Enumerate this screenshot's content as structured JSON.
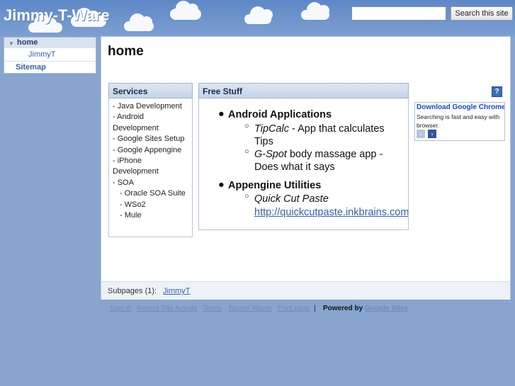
{
  "header": {
    "site_title": "Jimmy-T-Ware",
    "search_placeholder": "",
    "search_button": "Search this site"
  },
  "sidebar": {
    "items": [
      {
        "label": "home",
        "expanded": true
      },
      {
        "label": "JimmyT"
      },
      {
        "label": "Sitemap"
      }
    ]
  },
  "page": {
    "title": "home"
  },
  "services": {
    "header": "Services",
    "items": [
      "- Java Development",
      "- Android",
      "Development",
      "- Google Sites Setup",
      "- Google Appengine",
      "- iPhone",
      "Development",
      "- SOA",
      "- Oracle SOA Suite",
      "- WSo2",
      "- Mule"
    ]
  },
  "free_stuff": {
    "header": "Free Stuff",
    "sections": [
      {
        "title": "Android Applications",
        "items": [
          {
            "name": "TipCalc",
            "desc_line1": " - App that calculates",
            "desc_line2": "Tips"
          },
          {
            "name": "G-Spot",
            "desc_line1": " body massage app  -",
            "desc_line2": "Does what it says"
          }
        ]
      },
      {
        "title": "Appengine Utilities",
        "items": [
          {
            "name": "Quick Cut Paste",
            "link": "http://quickcutpaste.inkbrains.com"
          }
        ]
      }
    ]
  },
  "ad": {
    "title": "Download Google Chrome",
    "text": "Searching is fast and easy with browser.",
    "prev": "‹",
    "next": "›"
  },
  "help_icon_label": "?",
  "subpages": {
    "label": "Subpages (1):",
    "link": "JimmyT"
  },
  "footer": {
    "links": [
      "Sign in",
      "Recent Site Activity",
      "Terms",
      "Report Abuse",
      "Print page"
    ],
    "separator": "|",
    "powered_by": "Powered by",
    "google_sites": "Google Sites"
  },
  "colors": {
    "background": "#87a5cf",
    "link": "#3561a6",
    "header_gradient_top": "#dde6f3"
  }
}
